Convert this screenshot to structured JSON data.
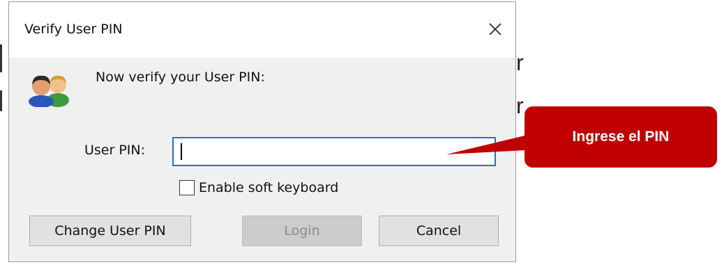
{
  "background": {
    "chars": [
      "r",
      "r"
    ]
  },
  "dialog": {
    "title": "Verify User PIN",
    "close_icon": "close-icon",
    "user_icon": "users-icon",
    "prompt": "Now verify your User PIN:",
    "pin_label": "User PIN:",
    "pin_value": "",
    "soft_keyboard_label": "Enable soft keyboard",
    "soft_keyboard_checked": false,
    "buttons": {
      "change": "Change User PIN",
      "login": "Login",
      "cancel": "Cancel"
    }
  },
  "annotation": {
    "text": "Ingrese el PIN",
    "color": "#c00000"
  }
}
